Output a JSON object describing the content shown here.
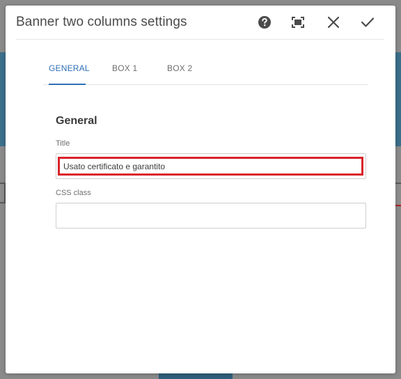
{
  "dialog": {
    "title": "Banner two columns settings",
    "actions": {
      "help_icon": "help-icon",
      "fullscreen_icon": "fullscreen-icon",
      "close_icon": "close-icon",
      "done_icon": "check-icon"
    }
  },
  "tabs": [
    {
      "label": "GENERAL",
      "active": true
    },
    {
      "label": "BOX 1",
      "active": false
    },
    {
      "label": "BOX 2",
      "active": false
    }
  ],
  "general": {
    "heading": "General",
    "title_label": "Title",
    "title_value": "Usato certificato e garantito",
    "css_label": "CSS class",
    "css_value": ""
  },
  "colors": {
    "accent": "#2f6fb5",
    "highlight": "#d9232a",
    "background_band": "#2e6a8a"
  }
}
